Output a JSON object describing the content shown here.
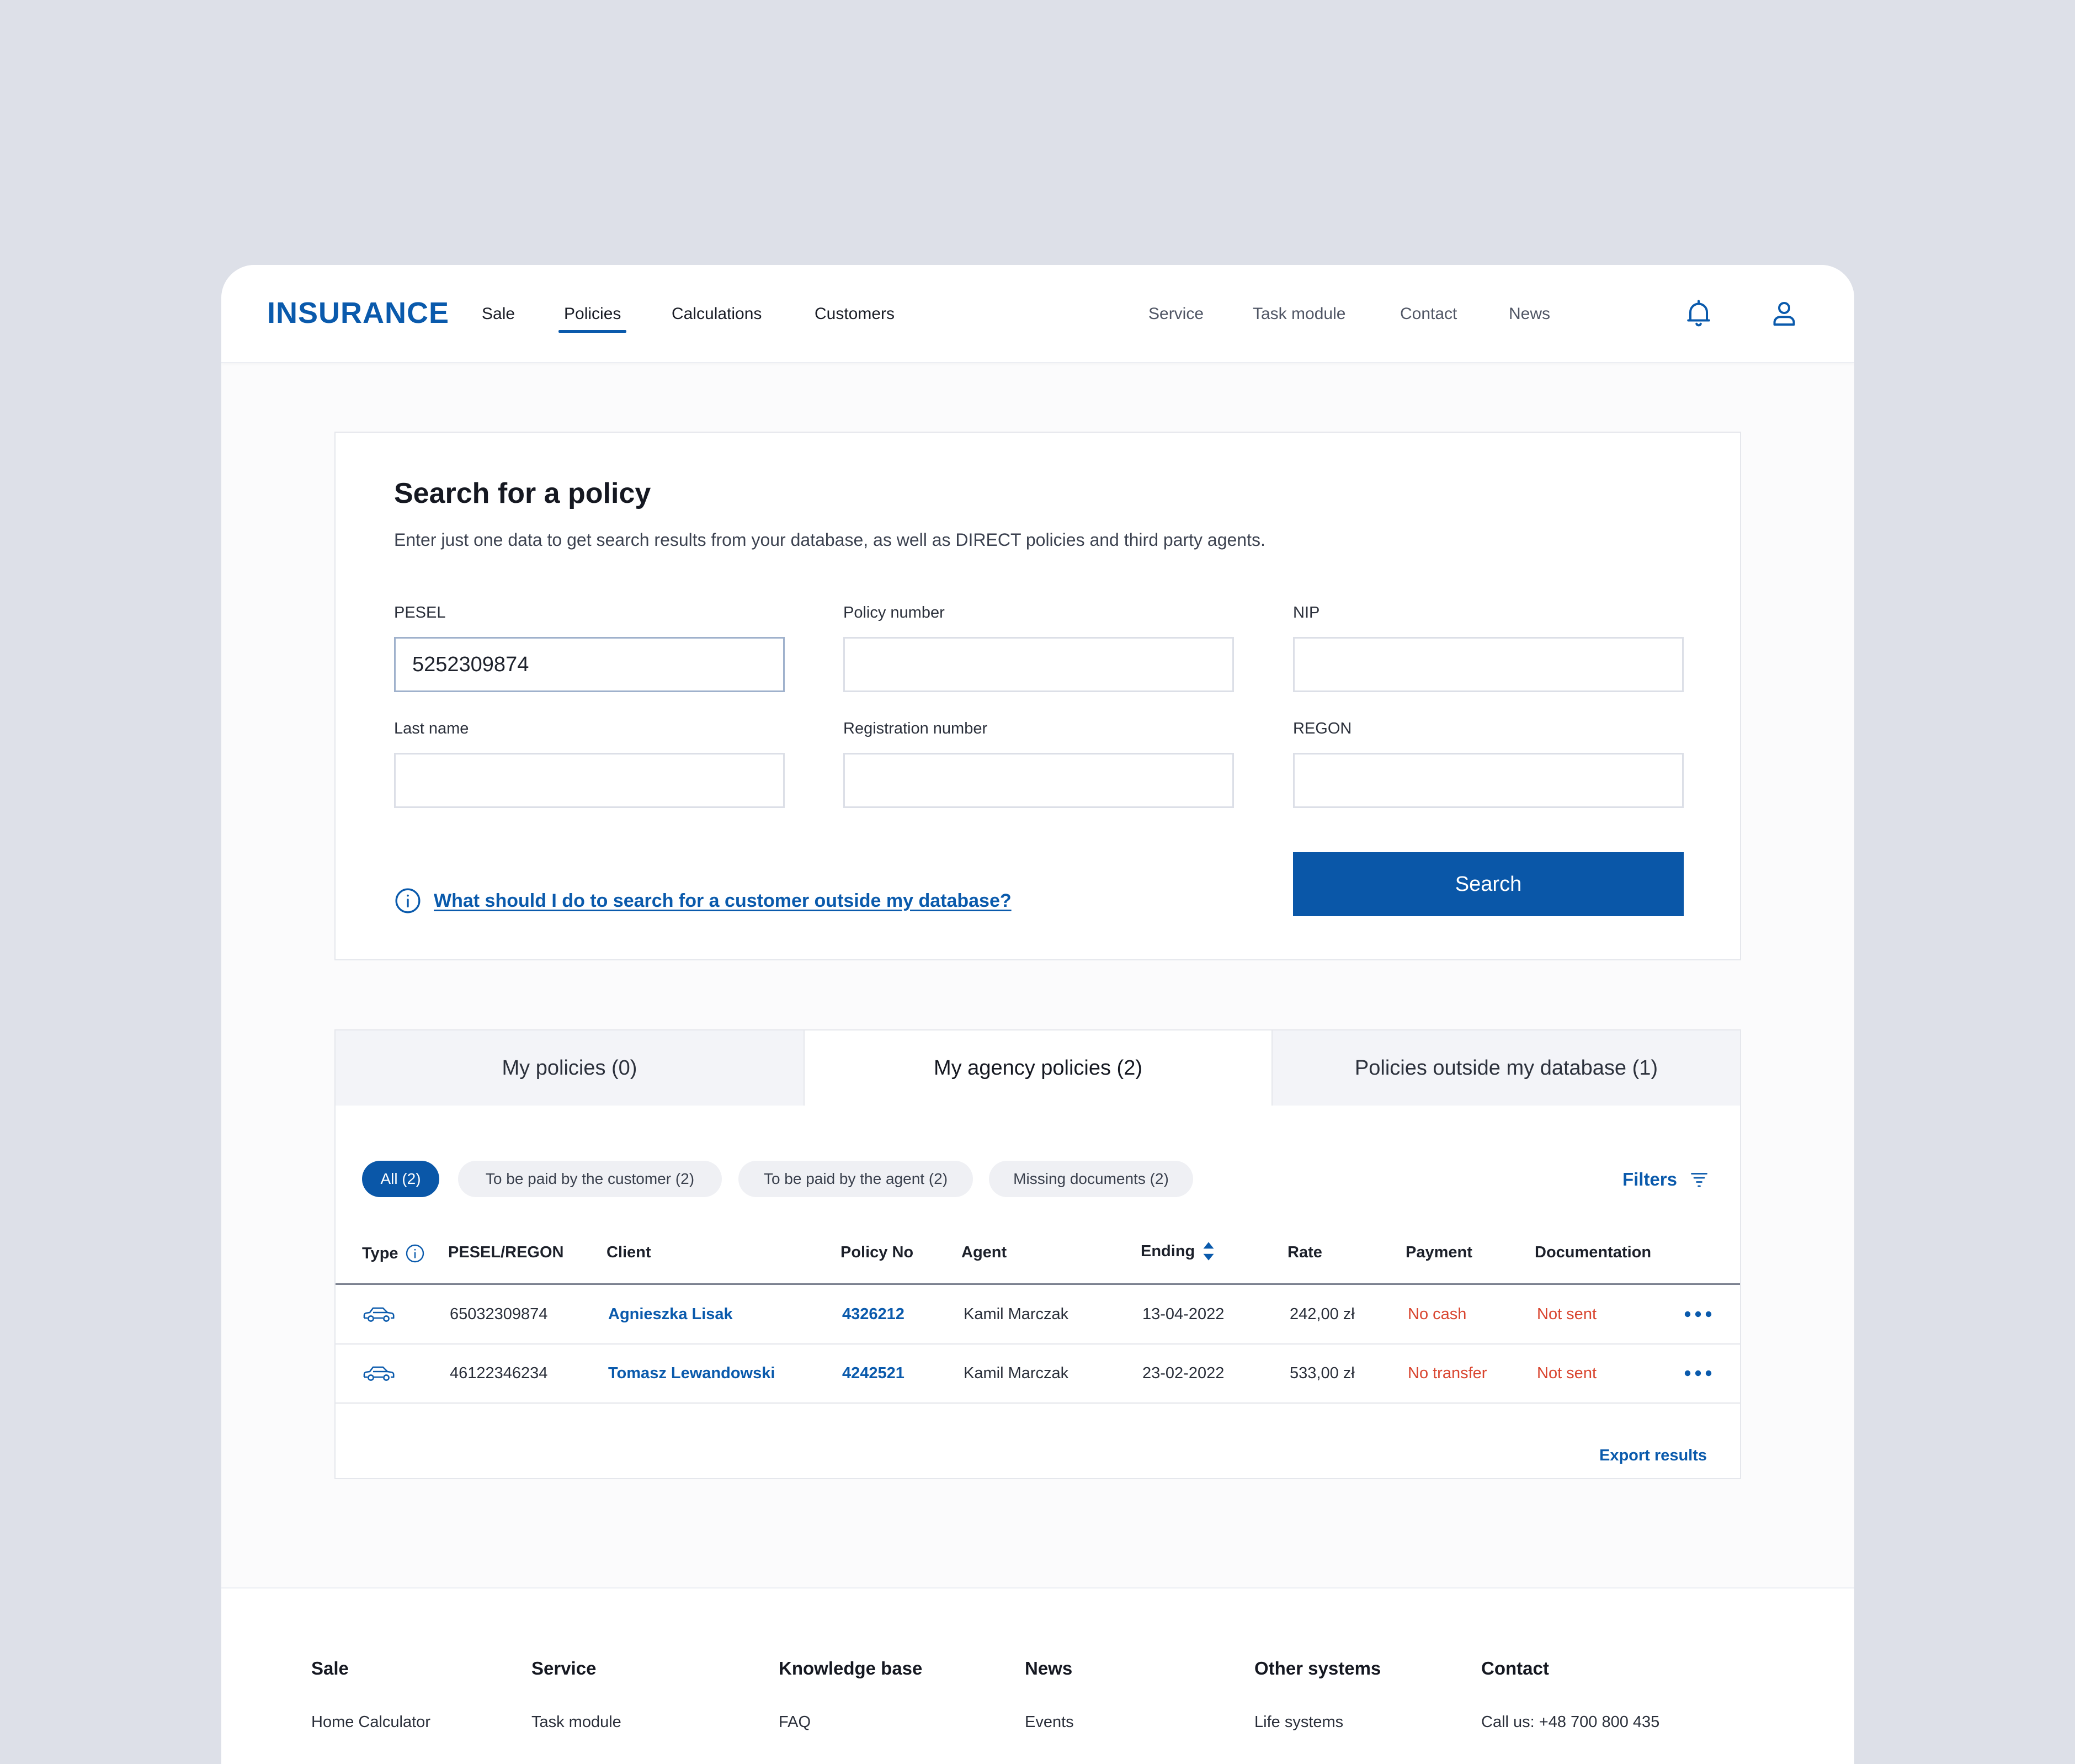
{
  "header": {
    "logo": "INSURANCE",
    "main_nav": [
      "Sale",
      "Policies",
      "Calculations",
      "Customers"
    ],
    "active_nav": "Policies",
    "secondary_nav": [
      "Service",
      "Task module",
      "Contact",
      "News"
    ],
    "icons": [
      "bell-icon",
      "user-icon"
    ]
  },
  "search": {
    "title": "Search for a policy",
    "subtitle": "Enter just one data to get search results from your database, as well as DIRECT policies and third party agents.",
    "fields": {
      "pesel": {
        "label": "PESEL",
        "value": "5252309874"
      },
      "policy_number": {
        "label": "Policy number",
        "value": ""
      },
      "nip": {
        "label": "NIP",
        "value": ""
      },
      "last_name": {
        "label": "Last name",
        "value": ""
      },
      "registration_number": {
        "label": "Registration number",
        "value": ""
      },
      "regon": {
        "label": "REGON",
        "value": ""
      }
    },
    "help_link": "What should I do to search for a customer outside my database?",
    "button": "Search"
  },
  "results": {
    "tabs": [
      "My policies (0)",
      "My agency policies (2)",
      "Policies outside my database (1)"
    ],
    "active_tab": "My agency policies (2)",
    "chips": [
      "All (2)",
      "To be paid by the customer (2)",
      "To be paid by the agent (2)",
      "Missing documents (2)"
    ],
    "active_chip": "All (2)",
    "filters_label": "Filters",
    "columns": [
      "Type",
      "PESEL/REGON",
      "Client",
      "Policy No",
      "Agent",
      "Ending",
      "Rate",
      "Payment",
      "Documentation"
    ],
    "rows": [
      {
        "type": "car-icon",
        "pesel": "65032309874",
        "client": "Agnieszka Lisak",
        "policy": "4326212",
        "agent": "Kamil Marczak",
        "ending": "13-04-2022",
        "rate": "242,00 zł",
        "payment": "No cash",
        "documentation": "Not sent"
      },
      {
        "type": "car-icon",
        "pesel": "46122346234",
        "client": "Tomasz Lewandowski",
        "policy": "4242521",
        "agent": "Kamil Marczak",
        "ending": "23-02-2022",
        "rate": "533,00 zł",
        "payment": "No transfer",
        "documentation": "Not sent"
      }
    ],
    "export": "Export results"
  },
  "footer": {
    "columns": [
      {
        "heading": "Sale",
        "link": "Home Calculator"
      },
      {
        "heading": "Service",
        "link": "Task module"
      },
      {
        "heading": "Knowledge base",
        "link": "FAQ"
      },
      {
        "heading": "News",
        "link": "Events"
      },
      {
        "heading": "Other systems",
        "link": "Life systems"
      },
      {
        "heading": "Contact",
        "link": "Call us: +48 700 800 435"
      }
    ]
  },
  "colors": {
    "brand": "#0a5aac",
    "alert": "#d9452f",
    "background": "#dde0e8"
  }
}
